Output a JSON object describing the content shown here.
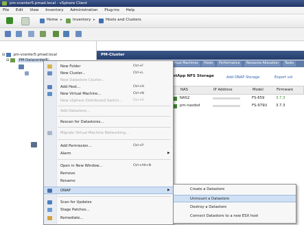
{
  "window": {
    "title": "pm-vcenter5.pmad.local - vSphere Client"
  },
  "menubar": {
    "items": [
      "File",
      "Edit",
      "View",
      "Inventory",
      "Administration",
      "Plug-ins",
      "Help"
    ]
  },
  "nav": {
    "home": "Home",
    "inventory": "Inventory",
    "hosts": "Hosts and Clusters"
  },
  "tree": {
    "root": "pm-vcenter5.pmad.local",
    "datacenter": "PM-Datacenter5"
  },
  "panel": {
    "title": "PM-Cluster",
    "tabs": [
      "Virtual Machines",
      "Hosts",
      "Performance",
      "Resource Allocation",
      "Tasks"
    ],
    "section_title": "NetApp NFS Storage",
    "add_link": "Add ONAP Storage",
    "export_link": "Export vol",
    "columns": [
      "NAS",
      "IP Address",
      "Model",
      "Firmware"
    ],
    "rows": [
      {
        "name": "NAS2",
        "ip": "",
        "model": "FS-659",
        "fw": "3.7.3"
      },
      {
        "name": "pm-nasdsd",
        "ip": "",
        "model": "FS-979U",
        "fw": "3.7.3"
      }
    ]
  },
  "context_menu": {
    "items": [
      {
        "label": "New Folder",
        "shortcut": "Ctrl+F"
      },
      {
        "label": "New Cluster...",
        "shortcut": "Ctrl+L"
      },
      {
        "label": "New Datastore Cluster...",
        "shortcut": ""
      },
      {
        "label": "Add Host...",
        "shortcut": "Ctrl+H"
      },
      {
        "label": "New Virtual Machine...",
        "shortcut": "Ctrl+N"
      },
      {
        "label": "New vSphere Distributed Switch...",
        "shortcut": "Ctrl+R"
      },
      {
        "label": "Add Datastore...",
        "shortcut": ""
      },
      {
        "label": "Rescan for Datastores...",
        "shortcut": ""
      },
      {
        "label": "Migrate Virtual Machine Networking...",
        "shortcut": ""
      },
      {
        "label": "Add Permission...",
        "shortcut": "Ctrl+P"
      },
      {
        "label": "Alarm",
        "shortcut": ""
      },
      {
        "label": "Open in New Window...",
        "shortcut": "Ctrl+Alt+N"
      },
      {
        "label": "Remove",
        "shortcut": ""
      },
      {
        "label": "Rename",
        "shortcut": ""
      },
      {
        "label": "ONAP",
        "shortcut": ""
      },
      {
        "label": "Scan for Updates",
        "shortcut": ""
      },
      {
        "label": "Stage Patches...",
        "shortcut": ""
      },
      {
        "label": "Remediate...",
        "shortcut": ""
      }
    ]
  },
  "submenu": {
    "items": [
      "Create a Datastore",
      "Unmount a Datastore",
      "Destroy a Datastore",
      "Connect Datastore to a new ESX host"
    ]
  },
  "colors": {
    "titlebar": "#1f3466",
    "header": "#2e4a7e",
    "highlight": "#cfe0f4",
    "accent_green": "#5a9a2b"
  }
}
